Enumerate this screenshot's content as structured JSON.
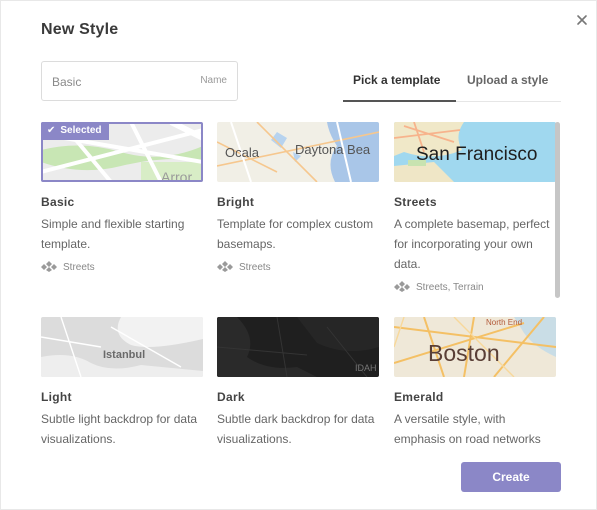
{
  "dialog": {
    "title": "New Style",
    "close_icon": "close-icon"
  },
  "name_field": {
    "value": "",
    "placeholder": "Basic",
    "label": "Name"
  },
  "tabs": [
    {
      "label": "Pick a template",
      "active": true
    },
    {
      "label": "Upload a style",
      "active": false
    }
  ],
  "templates": [
    {
      "title": "Basic",
      "description": "Simple and flexible starting template.",
      "tag": "Streets",
      "selected": true,
      "badge": "Selected",
      "map_label": "Arror"
    },
    {
      "title": "Bright",
      "description": "Template for complex custom basemaps.",
      "tag": "Streets",
      "selected": false,
      "map_label_1": "Ocala",
      "map_label_2": "Daytona Bea"
    },
    {
      "title": "Streets",
      "description": "A complete basemap, perfect for incorporating your own data.",
      "tag": "Streets, Terrain",
      "selected": false,
      "map_label": "San Francisco"
    },
    {
      "title": "Light",
      "description": "Subtle light backdrop for data visualizations.",
      "selected": false,
      "map_label": "Istanbul"
    },
    {
      "title": "Dark",
      "description": "Subtle dark backdrop for data visualizations.",
      "selected": false,
      "map_label": "IDAH"
    },
    {
      "title": "Emerald",
      "description": "A versatile style, with emphasis on road networks",
      "selected": false,
      "map_label": "Boston",
      "map_label_2": "North End"
    }
  ],
  "create_button": {
    "label": "Create"
  },
  "colors": {
    "accent": "#8b87c7",
    "scrollbar": "#c6c6c6"
  }
}
